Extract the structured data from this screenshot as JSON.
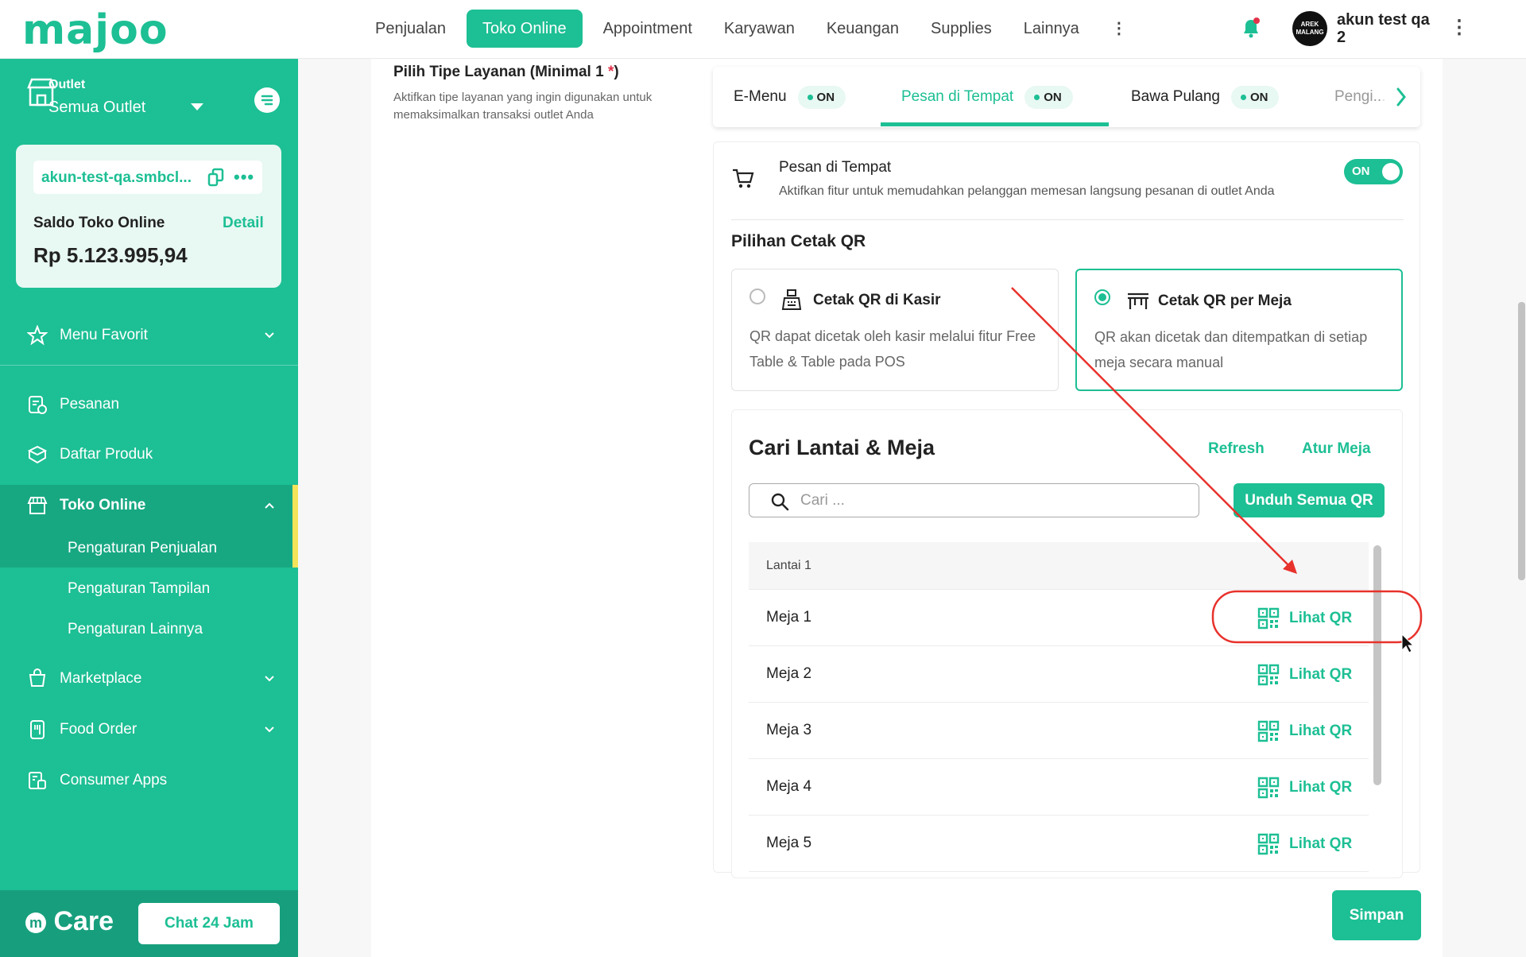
{
  "brand": {
    "logo": "majoo",
    "accent": "#1dbf94"
  },
  "topnav": {
    "items": [
      "Penjualan",
      "Toko Online",
      "Appointment",
      "Karyawan",
      "Keuangan",
      "Supplies",
      "Lainnya"
    ],
    "active": "Toko Online"
  },
  "user": {
    "avatar_text": "AREK MALANG",
    "name": "akun test qa 2"
  },
  "sidebar": {
    "outlet_label": "Outlet",
    "outlet_value": "Semua Outlet",
    "domain": "akun-test-qa.smbcl...",
    "saldo_label": "Saldo Toko Online",
    "saldo_detail": "Detail",
    "saldo_value": "Rp 5.123.995,94",
    "items": [
      {
        "label": "Menu Favorit",
        "icon": "star-icon"
      },
      {
        "label": "Pesanan",
        "icon": "order-icon"
      },
      {
        "label": "Daftar Produk",
        "icon": "box-icon"
      },
      {
        "label": "Toko Online",
        "icon": "store-icon"
      },
      {
        "label": "Marketplace",
        "icon": "marketplace-icon"
      },
      {
        "label": "Food Order",
        "icon": "food-order-icon"
      },
      {
        "label": "Consumer Apps",
        "icon": "consumer-apps-icon"
      }
    ],
    "subitems": [
      "Pengaturan Penjualan",
      "Pengaturan Tampilan",
      "Pengaturan Lainnya"
    ],
    "care_logo": "Care",
    "care_chat": "Chat 24 Jam"
  },
  "main": {
    "req_title": "Pilih Tipe Layanan (Minimal 1 ",
    "req_star": "*",
    "req_close": ")",
    "req_desc": "Aktifkan tipe layanan yang ingin digunakan untuk memaksimalkan transaksi outlet Anda",
    "tabs": [
      {
        "label": "E-Menu",
        "status": "ON"
      },
      {
        "label": "Pesan di Tempat",
        "status": "ON"
      },
      {
        "label": "Bawa Pulang",
        "status": "ON"
      },
      {
        "label": "Pengi..."
      }
    ],
    "active_tab": "Pesan di Tempat",
    "service": {
      "title": "Pesan di Tempat",
      "desc": "Aktifkan fitur untuk memudahkan pelanggan memesan langsung pesanan di outlet Anda",
      "toggle": "ON"
    },
    "qr_heading": "Pilihan Cetak QR",
    "qr_options": [
      {
        "title": "Cetak QR di Kasir",
        "desc": "QR dapat dicetak oleh kasir melalui fitur Free Table & Table pada POS",
        "selected": false
      },
      {
        "title": "Cetak QR per Meja",
        "desc": "QR akan dicetak dan ditempatkan di setiap meja secara manual",
        "selected": true
      }
    ],
    "search_section": {
      "title": "Cari Lantai & Meja",
      "refresh": "Refresh",
      "atur_meja": "Atur Meja",
      "placeholder": "Cari ...",
      "download_all": "Unduh Semua QR",
      "floor": "Lantai 1",
      "rows": [
        {
          "name": "Meja 1",
          "action": "Lihat QR"
        },
        {
          "name": "Meja 2",
          "action": "Lihat QR"
        },
        {
          "name": "Meja 3",
          "action": "Lihat QR"
        },
        {
          "name": "Meja 4",
          "action": "Lihat QR"
        },
        {
          "name": "Meja 5",
          "action": "Lihat QR"
        }
      ]
    },
    "save": "Simpan"
  }
}
